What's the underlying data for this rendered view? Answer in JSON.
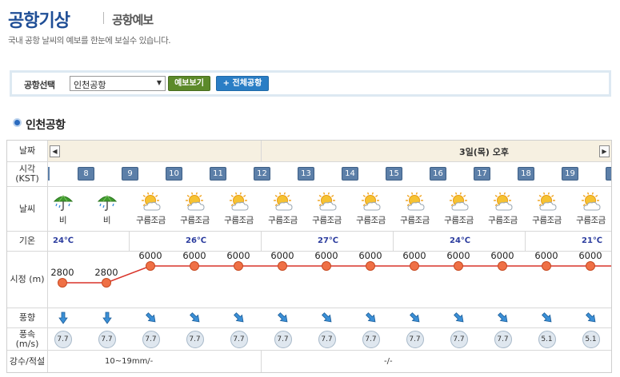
{
  "header": {
    "title": "공항기상",
    "subtitle": "공항예보",
    "description": "국내 공항 날씨의 예보를 한눈에 보실수 있습니다."
  },
  "search": {
    "label": "공항선택",
    "selected": "인천공항",
    "forecast_button": "예보보기",
    "all_button": "+ 전체공항"
  },
  "airport_name": "인천공항",
  "table": {
    "row_labels": {
      "date": "날짜",
      "time": "시각 (KST)",
      "weather": "날씨",
      "temp": "기온",
      "visibility": "시정 (m)",
      "wind_dir": "풍향",
      "wind_speed": "풍속 (m/s)",
      "rain": "강수/적설"
    },
    "date_text": "3일(목) 오후",
    "hours": [
      "8",
      "9",
      "10",
      "11",
      "12",
      "13",
      "14",
      "15",
      "16",
      "17",
      "18",
      "19",
      "2"
    ],
    "weather": [
      "비",
      "비",
      "구름조금",
      "구름조금",
      "구름조금",
      "구름조금",
      "구름조금",
      "구름조금",
      "구름조금",
      "구름조금",
      "구름조금",
      "구름조금",
      "구름조금"
    ],
    "temps": [
      "24℃",
      "26℃",
      "27℃",
      "24℃",
      "21℃"
    ],
    "visibility": [
      "2800",
      "2800",
      "6000",
      "6000",
      "6000",
      "6000",
      "6000",
      "6000",
      "6000",
      "6000",
      "6000",
      "6000",
      "6000"
    ],
    "wind_speed": [
      "7.7",
      "7.7",
      "7.7",
      "7.7",
      "7.7",
      "7.7",
      "7.7",
      "7.7",
      "7.7",
      "7.7",
      "7.7",
      "5.1",
      "5.1"
    ],
    "rain": [
      "10~19mm/-",
      "-/-"
    ]
  },
  "colors": {
    "title": "#1f4e96",
    "vis_line": "#d9342a",
    "vis_dot": "#ef7045",
    "temp_text": "#2b3c9e"
  }
}
